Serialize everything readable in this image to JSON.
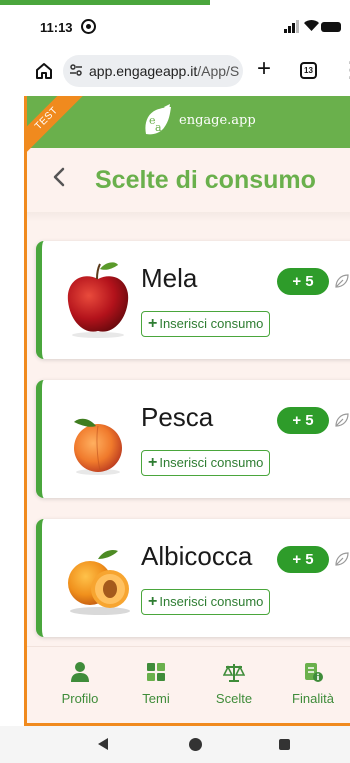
{
  "status_bar": {
    "time": "11:13"
  },
  "browser": {
    "url_host": "app.engageapp.it",
    "url_path": "/App/S",
    "tab_count": "13"
  },
  "app": {
    "test_badge": "TEST",
    "logo_text": "engage.app",
    "logo_letters": "ea",
    "page_title": "Scelte di consumo"
  },
  "cards": [
    {
      "name": "Mela",
      "score": "+ 5",
      "add_label": "Inserisci consumo",
      "icon": "apple-image"
    },
    {
      "name": "Pesca",
      "score": "+ 5",
      "add_label": "Inserisci consumo",
      "icon": "peach-image"
    },
    {
      "name": "Albicocca",
      "score": "+ 5",
      "add_label": "Inserisci consumo",
      "icon": "apricot-image"
    }
  ],
  "bottom_nav": [
    {
      "label": "Profilo",
      "icon": "person-icon"
    },
    {
      "label": "Temi",
      "icon": "grid-icon"
    },
    {
      "label": "Scelte",
      "icon": "scale-icon"
    },
    {
      "label": "Finalità",
      "icon": "document-info-icon"
    }
  ],
  "colors": {
    "brand_green": "#6ab04c",
    "accent_orange": "#f08a1e",
    "score_green": "#2e9c2a",
    "background": "#fdf2ee"
  }
}
